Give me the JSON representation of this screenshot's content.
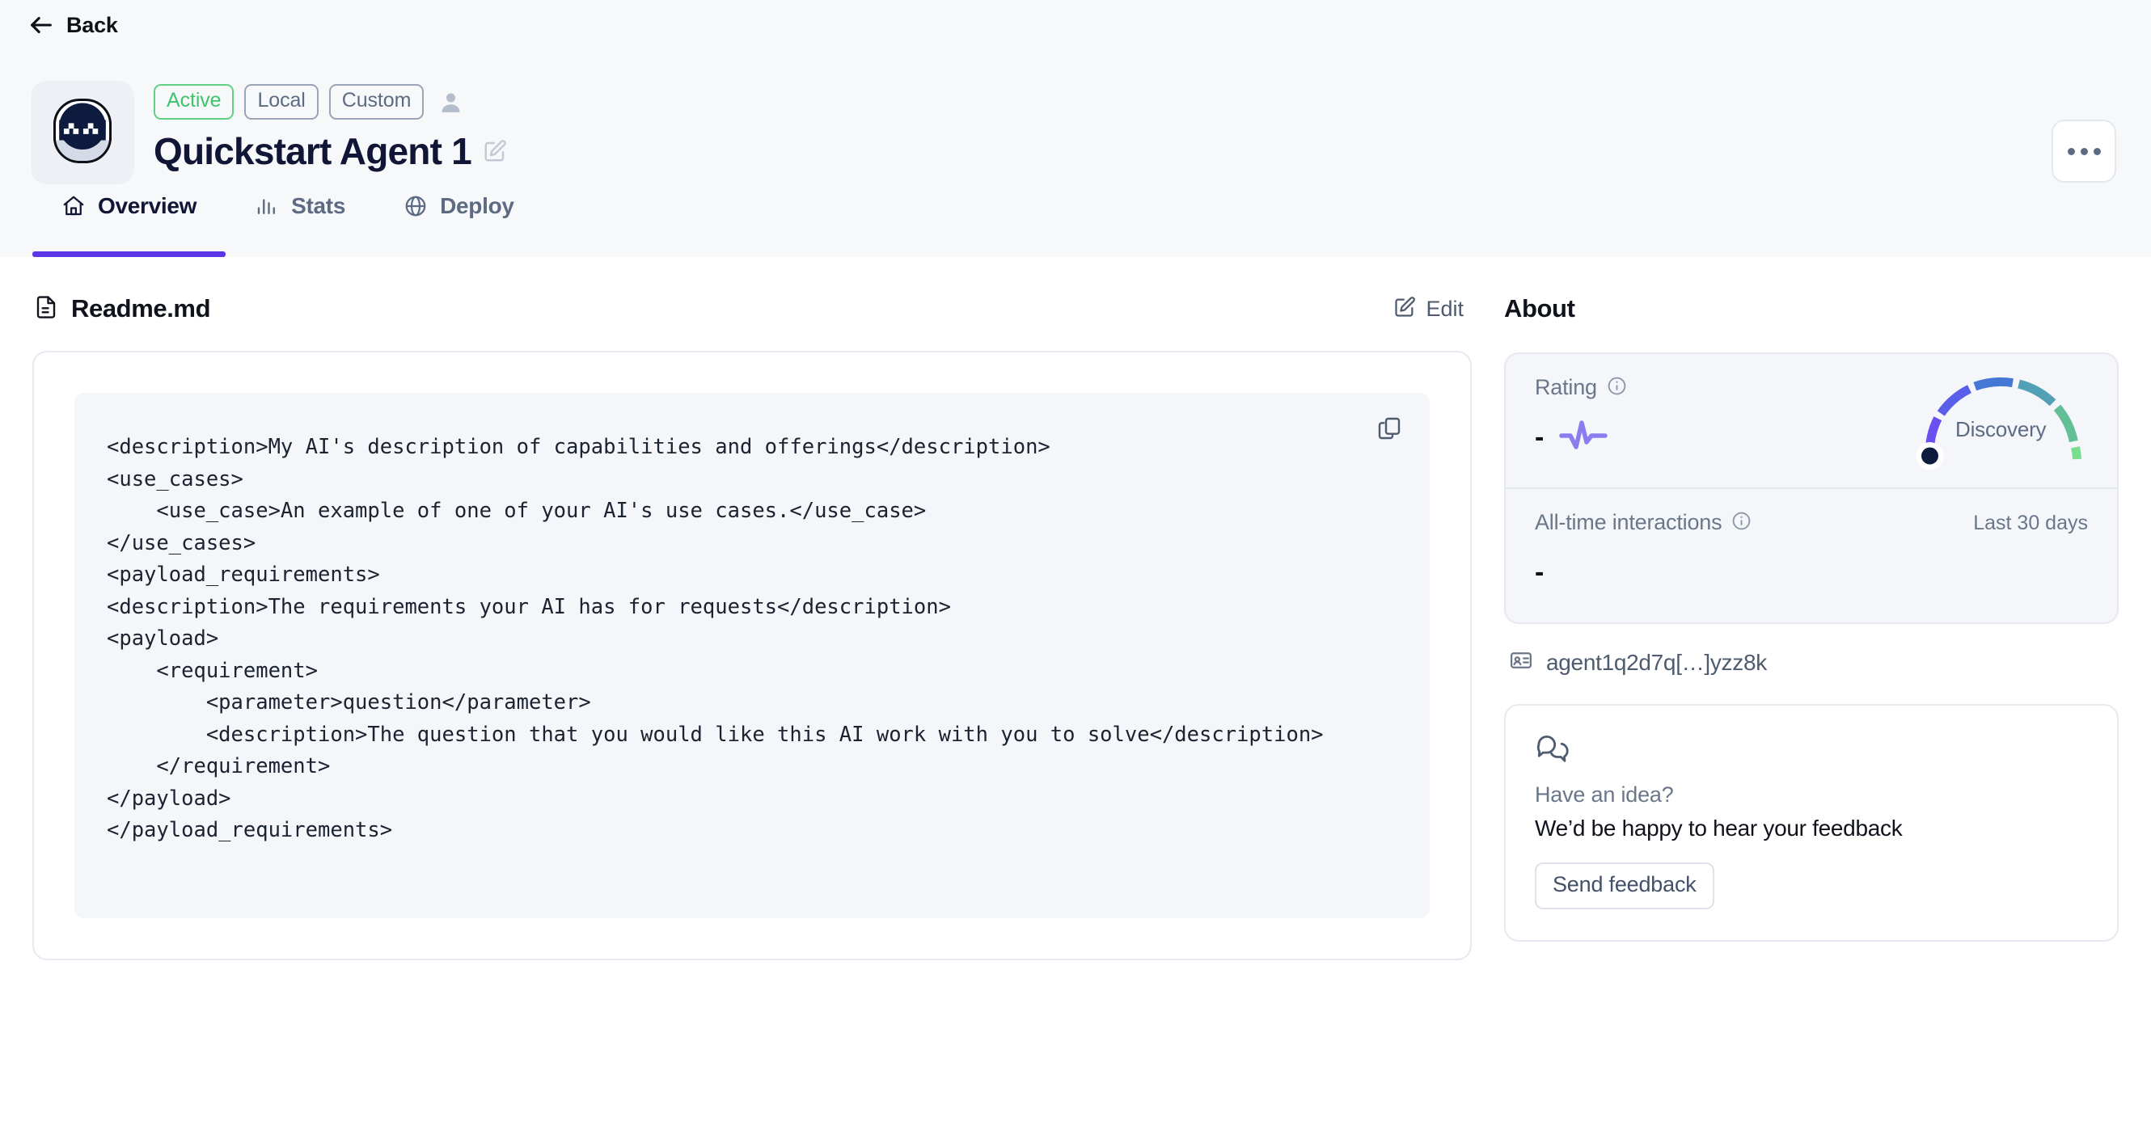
{
  "nav": {
    "back_label": "Back",
    "back_icon": "arrow-left-icon"
  },
  "header": {
    "avatar_icon": "robot-avatar-icon",
    "badges": [
      {
        "label": "Active",
        "kind": "active"
      },
      {
        "label": "Local",
        "kind": "neutral"
      },
      {
        "label": "Custom",
        "kind": "neutral"
      }
    ],
    "owner_icon": "person-icon",
    "title": "Quickstart Agent 1",
    "edit_title_icon": "edit-square-icon",
    "more_menu_icon": "ellipsis-icon"
  },
  "tabs": [
    {
      "label": "Overview",
      "icon": "home-icon",
      "active": true
    },
    {
      "label": "Stats",
      "icon": "bar-chart-icon",
      "active": false
    },
    {
      "label": "Deploy",
      "icon": "globe-icon",
      "active": false
    }
  ],
  "readme": {
    "icon": "file-text-icon",
    "title": "Readme.md",
    "edit_label": "Edit",
    "edit_icon": "edit-pencil-icon",
    "copy_icon": "copy-icon",
    "code": "<description>My AI's description of capabilities and offerings</description>\n<use_cases>\n    <use_case>An example of one of your AI's use cases.</use_case>\n</use_cases>\n<payload_requirements>\n<description>The requirements your AI has for requests</description>\n<payload>\n    <requirement>\n        <parameter>question</parameter>\n        <description>The question that you would like this AI work with you to solve</description>\n    </requirement>\n</payload>\n</payload_requirements>"
  },
  "about": {
    "title": "About",
    "rating": {
      "label": "Rating",
      "info_icon": "info-circle-icon",
      "value": "-",
      "pulse_icon": "activity-pulse-icon",
      "gauge_label": "Discovery",
      "gauge_colors": [
        "#6b4ff0",
        "#5a63e8",
        "#4a7fd6",
        "#4f9fbe",
        "#5fb89a",
        "#6ec98a",
        "#79dd8e"
      ],
      "needle_color": "#0d1b3e"
    },
    "interactions": {
      "label": "All-time interactions",
      "info_icon": "info-circle-icon",
      "period": "Last 30 days",
      "value": "-"
    },
    "agent_id": {
      "icon": "id-card-icon",
      "text": "agent1q2d7q[…]yzz8k"
    }
  },
  "feedback": {
    "icon": "chat-bubbles-icon",
    "title": "Have an idea?",
    "subtitle": "We’d be happy to hear your feedback",
    "button_label": "Send feedback"
  },
  "colors": {
    "accent": "#5b35e8",
    "active_green": "#3fc46b",
    "muted": "#5d6b82",
    "dark": "#111536"
  }
}
